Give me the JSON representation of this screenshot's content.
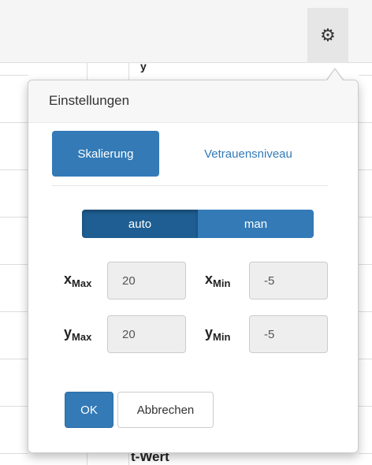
{
  "toolbar": {
    "settings_icon": "gear-icon",
    "settings_glyph": "⚙"
  },
  "background": {
    "column_header_partial": "y",
    "row_label": "t-Wert"
  },
  "popover": {
    "title": "Einstellungen",
    "tabs": [
      {
        "label": "Skalierung",
        "active": true
      },
      {
        "label": "Vetrauensniveau",
        "active": false
      }
    ],
    "mode": {
      "options": [
        "auto",
        "man"
      ],
      "selected": "auto"
    },
    "fields": {
      "x_max": {
        "label_main": "x",
        "label_sub": "Max",
        "value": "20"
      },
      "x_min": {
        "label_main": "x",
        "label_sub": "Min",
        "value": "-5"
      },
      "y_max": {
        "label_main": "y",
        "label_sub": "Max",
        "value": "20"
      },
      "y_min": {
        "label_main": "y",
        "label_sub": "Min",
        "value": "-5"
      }
    },
    "buttons": {
      "ok": "OK",
      "cancel": "Abbrechen"
    }
  },
  "colors": {
    "primary": "#337ab7",
    "primary_active": "#1f5e92",
    "header_bg": "#f7f7f7"
  }
}
